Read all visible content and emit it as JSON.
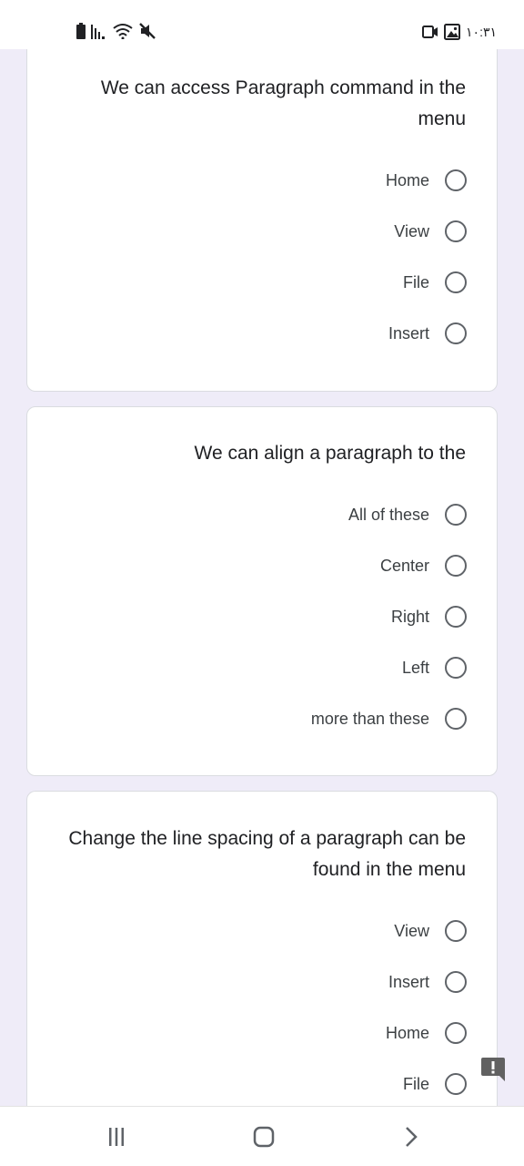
{
  "status_bar": {
    "time": "١٠:٣١",
    "icons": [
      "battery-icon",
      "signal-icon",
      "wifi-icon",
      "mute-icon",
      "video-icon",
      "gallery-icon"
    ]
  },
  "questions": [
    {
      "text": "We can access Paragraph command in the menu",
      "options": [
        "Home",
        "View",
        "File",
        "Insert"
      ]
    },
    {
      "text": "We can align a paragraph to the",
      "options": [
        "All of these",
        "Center",
        "Right",
        "Left",
        "more than these"
      ]
    },
    {
      "text": "Change the line spacing of a paragraph can be found in the menu",
      "options": [
        "View",
        "Insert",
        "Home",
        "File"
      ]
    }
  ],
  "nav": {
    "icons": [
      "recent-apps-icon",
      "home-icon",
      "back-icon"
    ]
  },
  "colors": {
    "page_background": "#efecf8",
    "card_background": "#ffffff",
    "radio_border": "#5f6368",
    "feedback_badge": "#616161"
  }
}
